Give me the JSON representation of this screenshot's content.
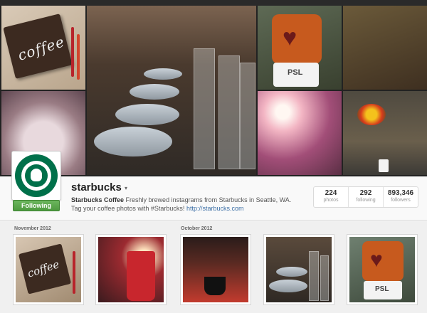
{
  "profile": {
    "username": "starbucks",
    "display_name": "Starbucks Coffee",
    "bio": "Freshly brewed instagrams from Starbucks in Seattle, WA. Tag your coffee photos with #Starbucks!",
    "website": "http://starbucks.com",
    "follow_label": "Following",
    "caret": "▾"
  },
  "stats": [
    {
      "count": "224",
      "label": "photos"
    },
    {
      "count": "292",
      "label": "following"
    },
    {
      "count": "893,346",
      "label": "followers"
    }
  ],
  "grid": {
    "months": [
      "November 2012",
      "October 2012"
    ]
  },
  "cover_tiles": {
    "coffee_word": "coffee",
    "psl_text": "PSL"
  },
  "thumbs": {
    "coffee_word": "coffee",
    "psl_text": "PSL"
  },
  "colors": {
    "brand_green": "#00704a",
    "follow_green": "#5aa84c",
    "link": "#3b6ea5"
  }
}
